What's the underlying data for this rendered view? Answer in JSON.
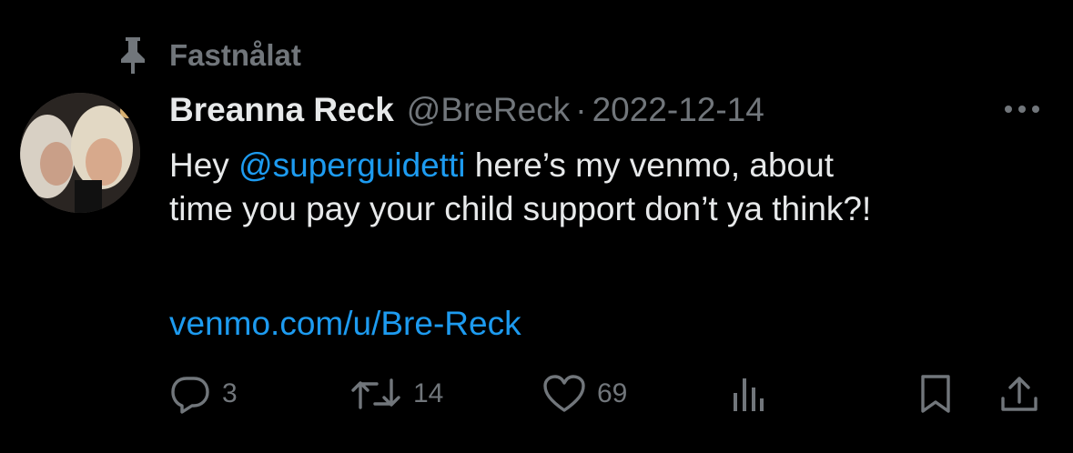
{
  "pinned": {
    "label": "Fastnålat",
    "icon": "pin-icon"
  },
  "tweet": {
    "author": {
      "display_name": "Breanna Reck",
      "handle": "@BreReck",
      "avatar_icon": "avatar-photo"
    },
    "separator": "·",
    "date": "2022-12-14",
    "text": {
      "line1_prefix": "Hey ",
      "mention": "@superguidetti",
      "line1_suffix": " here’s my venmo, about",
      "line2": "time you pay your child support don’t ya think?!"
    },
    "link": "venmo.com/u/Bre-Reck",
    "stats": {
      "replies": "3",
      "retweets": "14",
      "likes": "69"
    }
  },
  "icons": {
    "more": "more-icon",
    "reply": "reply-icon",
    "retweet": "retweet-icon",
    "like": "heart-icon",
    "views": "analytics-icon",
    "bookmark": "bookmark-icon",
    "share": "share-icon"
  },
  "colors": {
    "background": "#000000",
    "text_primary": "#e7e9ea",
    "text_secondary": "#71767b",
    "accent": "#1d9bf0"
  }
}
